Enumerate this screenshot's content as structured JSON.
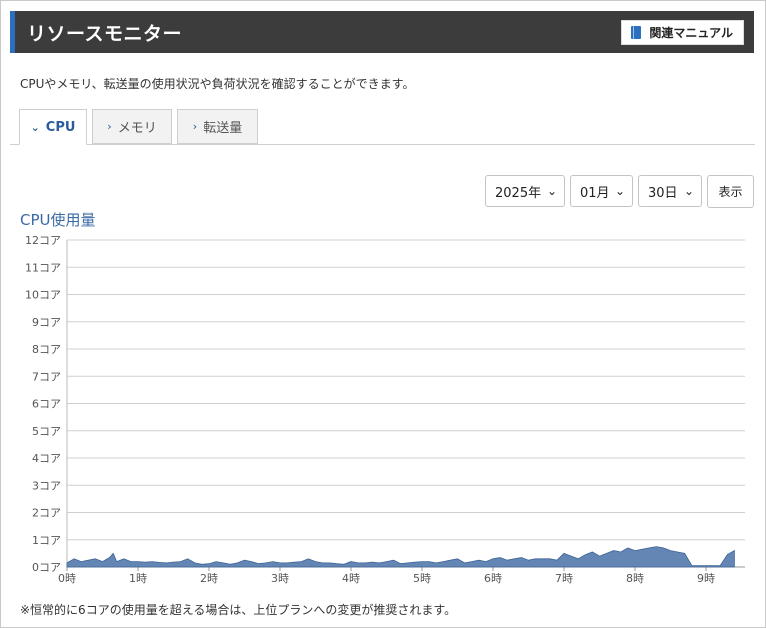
{
  "header": {
    "title": "リソースモニター",
    "manual_label": "関連マニュアル",
    "manual_icon": "book-icon"
  },
  "intro": "CPUやメモリ、転送量の使用状況や負荷状況を確認することができます。",
  "tabs": [
    {
      "label": "CPU",
      "active": true
    },
    {
      "label": "メモリ",
      "active": false
    },
    {
      "label": "転送量",
      "active": false
    }
  ],
  "controls": {
    "year": "2025年",
    "month": "01月",
    "day": "30日",
    "show_label": "表示"
  },
  "chart_title": "CPU使用量",
  "note": "※恒常的に6コアの使用量を超える場合は、上位プランへの変更が推奨されます。",
  "chart_data": {
    "type": "area",
    "title": "CPU使用量",
    "y_unit": "コア",
    "ylim": [
      0,
      12
    ],
    "y_ticks": [
      "0コア",
      "1コア",
      "2コア",
      "3コア",
      "4コア",
      "5コア",
      "6コア",
      "7コア",
      "8コア",
      "9コア",
      "10コア",
      "11コア",
      "12コア"
    ],
    "x_ticks": [
      "0時",
      "1時",
      "2時",
      "3時",
      "4時",
      "5時",
      "6時",
      "7時",
      "8時",
      "9時"
    ],
    "xlim": [
      0,
      9.4
    ],
    "color": "#5b7fb0",
    "grid": true,
    "series": [
      {
        "x": [
          0,
          0.1,
          0.2,
          0.3,
          0.4,
          0.5,
          0.6,
          0.65,
          0.7,
          0.8,
          0.9,
          1.0,
          1.1,
          1.2,
          1.3,
          1.4,
          1.5,
          1.6,
          1.7,
          1.8,
          1.9,
          2.0,
          2.1,
          2.2,
          2.3,
          2.4,
          2.5,
          2.6,
          2.7,
          2.8,
          2.9,
          3.0,
          3.1,
          3.2,
          3.3,
          3.4,
          3.5,
          3.6,
          3.7,
          3.8,
          3.9,
          4.0,
          4.1,
          4.2,
          4.3,
          4.4,
          4.5,
          4.6,
          4.7,
          4.8,
          4.9,
          5.0,
          5.1,
          5.2,
          5.3,
          5.4,
          5.5,
          5.6,
          5.7,
          5.8,
          5.9,
          6.0,
          6.1,
          6.2,
          6.3,
          6.4,
          6.5,
          6.6,
          6.7,
          6.8,
          6.9,
          7.0,
          7.1,
          7.2,
          7.3,
          7.4,
          7.5,
          7.6,
          7.7,
          7.8,
          7.9,
          8.0,
          8.1,
          8.2,
          8.3,
          8.4,
          8.5,
          8.6,
          8.7,
          8.8,
          8.9,
          9.0,
          9.1,
          9.2,
          9.3,
          9.4
        ],
        "values": [
          0.15,
          0.3,
          0.2,
          0.25,
          0.3,
          0.2,
          0.35,
          0.5,
          0.2,
          0.3,
          0.2,
          0.2,
          0.18,
          0.2,
          0.17,
          0.15,
          0.18,
          0.2,
          0.3,
          0.15,
          0.1,
          0.12,
          0.2,
          0.15,
          0.1,
          0.15,
          0.25,
          0.2,
          0.12,
          0.15,
          0.2,
          0.15,
          0.15,
          0.18,
          0.2,
          0.3,
          0.2,
          0.15,
          0.15,
          0.12,
          0.1,
          0.2,
          0.15,
          0.15,
          0.18,
          0.15,
          0.2,
          0.25,
          0.12,
          0.15,
          0.18,
          0.2,
          0.2,
          0.15,
          0.2,
          0.25,
          0.3,
          0.15,
          0.2,
          0.25,
          0.2,
          0.3,
          0.35,
          0.25,
          0.3,
          0.35,
          0.25,
          0.3,
          0.3,
          0.3,
          0.25,
          0.5,
          0.4,
          0.3,
          0.45,
          0.55,
          0.4,
          0.5,
          0.6,
          0.55,
          0.7,
          0.6,
          0.65,
          0.7,
          0.75,
          0.7,
          0.6,
          0.55,
          0.5,
          0.05,
          0.05,
          0.05,
          0.05,
          0.05,
          0.45,
          0.6
        ]
      }
    ]
  }
}
